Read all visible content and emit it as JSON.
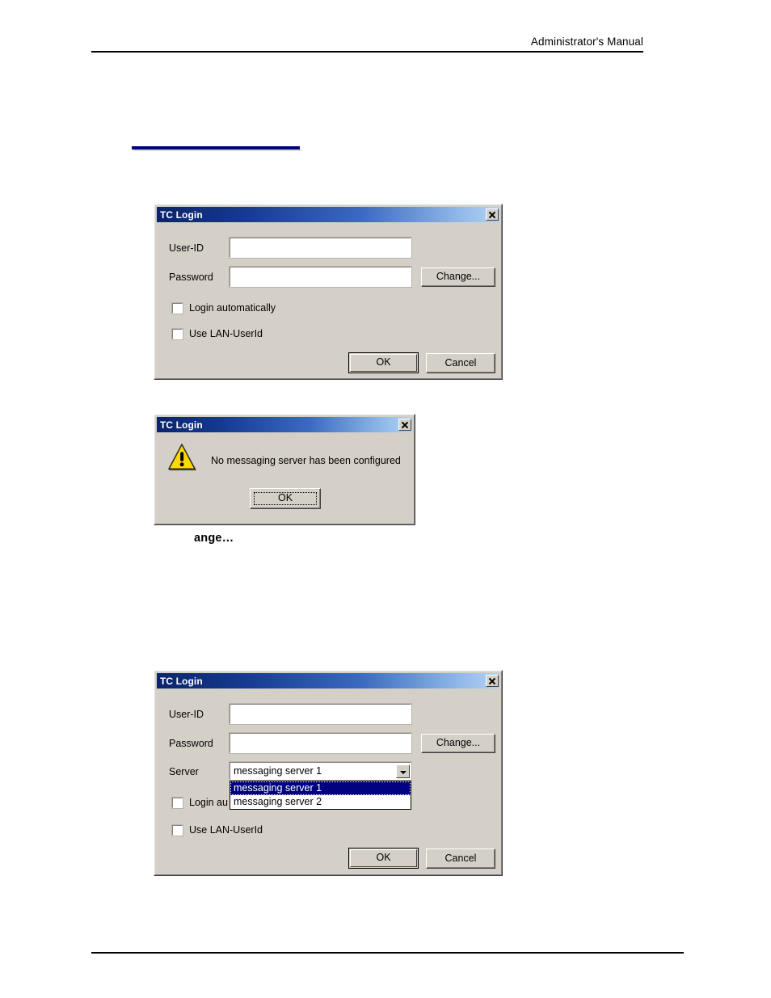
{
  "document": {
    "header_title": "Administrator's Manual",
    "caption_fragment": "ange…"
  },
  "dialog_login": {
    "title": "TC Login",
    "close_icon": "close-icon",
    "fields": {
      "userid_label": "User-ID",
      "userid_value": "",
      "password_label": "Password",
      "password_value": ""
    },
    "change_button": "Change...",
    "checkboxes": [
      {
        "label": "Login automatically",
        "checked": false
      },
      {
        "label": "Use LAN-UserId",
        "checked": false
      }
    ],
    "ok_button": "OK",
    "cancel_button": "Cancel"
  },
  "dialog_message": {
    "title": "TC Login",
    "close_icon": "close-icon",
    "icon": "warning-icon",
    "message": "No messaging server has been configured",
    "ok_button": "OK"
  },
  "dialog_login_server": {
    "title": "TC Login",
    "close_icon": "close-icon",
    "fields": {
      "userid_label": "User-ID",
      "userid_value": "",
      "password_label": "Password",
      "password_value": "",
      "server_label": "Server",
      "server_value": "messaging server 1"
    },
    "change_button": "Change...",
    "dropdown_icon": "chevron-down-icon",
    "server_options": [
      {
        "label": "messaging server 1",
        "selected": true
      },
      {
        "label": "messaging server 2",
        "selected": false
      }
    ],
    "checkboxes": [
      {
        "label": "Login au",
        "checked": false
      },
      {
        "label": "Use LAN-UserId",
        "checked": false
      }
    ],
    "ok_button": "OK",
    "cancel_button": "Cancel"
  },
  "colors": {
    "dialog_face": "#d4d0c8",
    "title_start": "#0a246a",
    "title_end": "#b4d2f5",
    "selection": "#000080",
    "accent_rule": "#000080",
    "warning": "#ffd800"
  }
}
